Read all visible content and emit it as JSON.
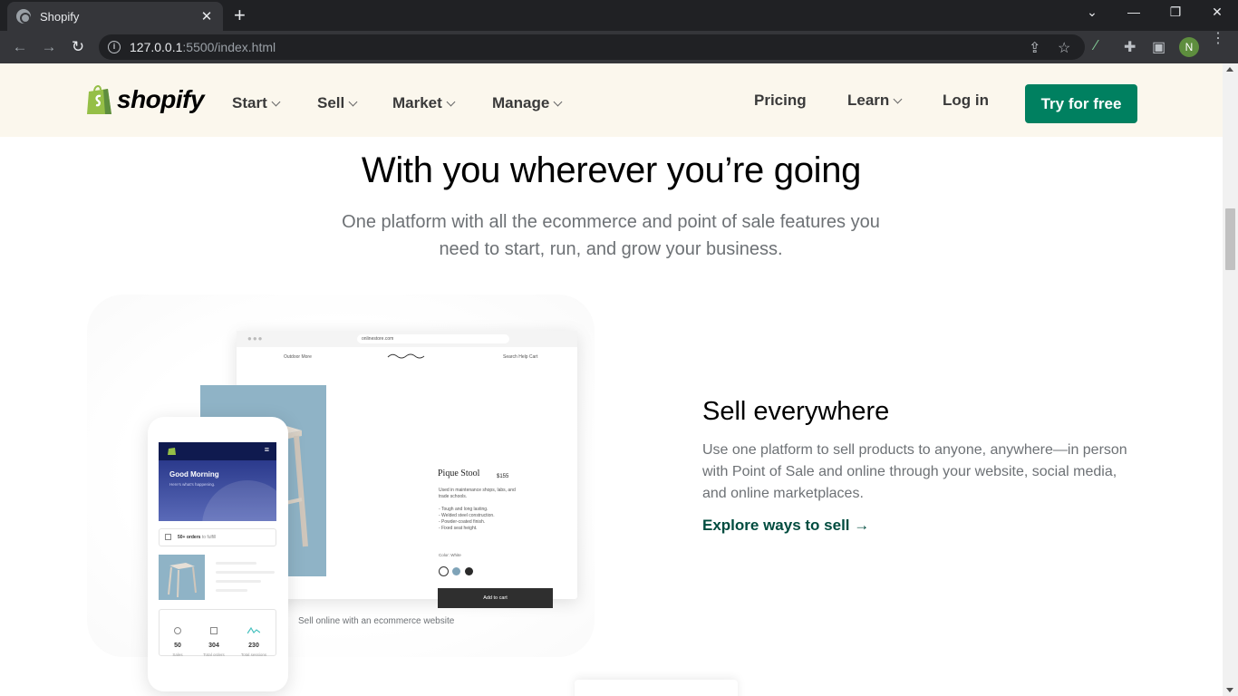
{
  "browser": {
    "tab_title": "Shopify",
    "tab_close": "✕",
    "new_tab": "+",
    "url_host": "127.0.0.1",
    "url_path": ":5500/index.html",
    "profile_initial": "N"
  },
  "header": {
    "brand": "shopify",
    "nav": [
      {
        "label": "Start"
      },
      {
        "label": "Sell"
      },
      {
        "label": "Market"
      },
      {
        "label": "Manage"
      }
    ],
    "pricing": "Pricing",
    "learn": "Learn",
    "login": "Log in",
    "cta": "Try for free",
    "accent": "#008060",
    "bg": "#fbf7ed"
  },
  "hero": {
    "title": "With you wherever you’re going",
    "subtitle": "One platform with all the ecommerce and point of sale features you need to start, run, and grow your business."
  },
  "mockup": {
    "address": "onlinestore.com",
    "subnav": "Outdoor   More",
    "rnav": "Search   Help   Cart",
    "product_name": "Pique Stool",
    "product_price": "$155",
    "product_desc": "Used in maintenance shops, labs, and trade schools.",
    "bullets": [
      "- Tough and long lasting.",
      "- Welded steel construction.",
      "- Powder-coated finish.",
      "- Fixed seat height."
    ],
    "color_label": "Color: White",
    "add_to_cart": "Add to cart",
    "phone_greeting": "Good Morning",
    "phone_sub": "Here's what's happening.",
    "orders_strong": "50+ orders",
    "orders_rest": " to fulfill",
    "stats": [
      {
        "value": "50",
        "label": "Sales"
      },
      {
        "value": "304",
        "label": "Total orders"
      },
      {
        "value": "230",
        "label": "Total sessions"
      }
    ],
    "caption": "Sell online with an ecommerce website"
  },
  "feature": {
    "title": "Sell everywhere",
    "body": "Use one platform to sell products to anyone, anywhere—in person with Point of Sale and online through your website, social media, and online marketplaces.",
    "link": "Explore ways to sell →",
    "link_color": "#004c3f"
  }
}
